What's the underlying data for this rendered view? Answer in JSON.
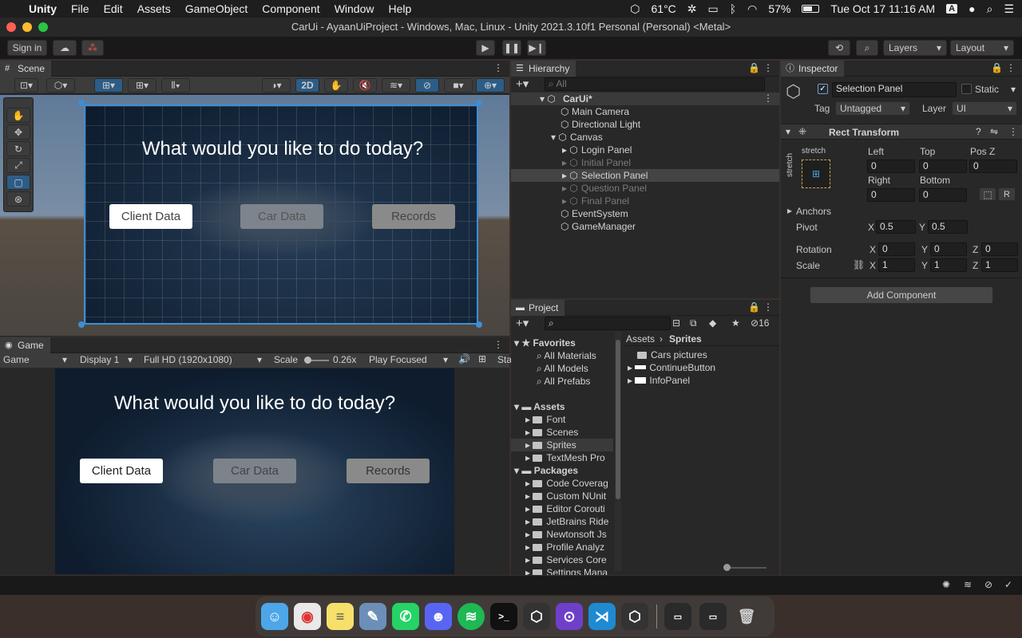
{
  "menubar": {
    "app": "Unity",
    "items": [
      "File",
      "Edit",
      "Assets",
      "GameObject",
      "Component",
      "Window",
      "Help"
    ],
    "temp": "61°C",
    "battery": "57%",
    "datetime": "Tue Oct 17  11:16 AM",
    "input": "A"
  },
  "window": {
    "title": "CarUi - AyaanUiProject - Windows, Mac, Linux - Unity 2021.3.10f1 Personal (Personal) <Metal>"
  },
  "toolbar": {
    "signin": "Sign in",
    "layers": "Layers",
    "layout": "Layout"
  },
  "scene": {
    "tab": "Scene",
    "mode_2d": "2D",
    "heading": "What would you like to do today?",
    "buttons": [
      "Client Data",
      "Car Data",
      "Records"
    ]
  },
  "game": {
    "tab": "Game",
    "display_mode": "Game",
    "display": "Display 1",
    "resolution": "Full HD (1920x1080)",
    "scale_label": "Scale",
    "scale_value": "0.26x",
    "play_mode": "Play Focused",
    "stats": "Sta",
    "heading": "What would you like to do today?",
    "buttons": [
      "Client Data",
      "Car Data",
      "Records"
    ]
  },
  "hierarchy": {
    "tab": "Hierarchy",
    "search_placeholder": "All",
    "scene_name": "CarUi*",
    "items": [
      {
        "label": "Main Camera",
        "indent": 1,
        "active": true
      },
      {
        "label": "Directional Light",
        "indent": 1,
        "active": true
      },
      {
        "label": "Canvas",
        "indent": 1,
        "active": true
      },
      {
        "label": "Login Panel",
        "indent": 2,
        "active": true
      },
      {
        "label": "Initial Panel",
        "indent": 2,
        "active": false
      },
      {
        "label": "Selection Panel",
        "indent": 2,
        "active": true,
        "selected": true
      },
      {
        "label": "Question Panel",
        "indent": 2,
        "active": false
      },
      {
        "label": "Final Panel",
        "indent": 2,
        "active": false
      },
      {
        "label": "EventSystem",
        "indent": 1,
        "active": true
      },
      {
        "label": "GameManager",
        "indent": 1,
        "active": true
      }
    ]
  },
  "project": {
    "tab": "Project",
    "hidden_count": "16",
    "favorites": {
      "label": "Favorites",
      "items": [
        "All Materials",
        "All Models",
        "All Prefabs"
      ]
    },
    "assets": {
      "label": "Assets",
      "items": [
        "Font",
        "Scenes",
        "Sprites",
        "TextMesh Pro"
      ]
    },
    "packages": {
      "label": "Packages",
      "items": [
        "Code Coverag",
        "Custom NUnit",
        "Editor Corouti",
        "JetBrains Ride",
        "Newtonsoft Js",
        "Profile Analyz",
        "Services Core",
        "Settings Mana"
      ]
    },
    "breadcrumb": [
      "Assets",
      "Sprites"
    ],
    "files": [
      "Cars pictures",
      "ContinueButton",
      "InfoPanel"
    ]
  },
  "inspector": {
    "tab": "Inspector",
    "object_name": "Selection Panel",
    "static_label": "Static",
    "tag_label": "Tag",
    "tag_value": "Untagged",
    "layer_label": "Layer",
    "layer_value": "UI",
    "rect": {
      "title": "Rect Transform",
      "stretch": "stretch",
      "left_label": "Left",
      "top_label": "Top",
      "posz_label": "Pos Z",
      "left": "0",
      "top": "0",
      "posz": "0",
      "right_label": "Right",
      "bottom_label": "Bottom",
      "right": "0",
      "bottom": "0",
      "r_btn": "R",
      "anchors": "Anchors",
      "pivot_label": "Pivot",
      "pivot_x": "0.5",
      "pivot_y": "0.5",
      "rotation_label": "Rotation",
      "rot_x": "0",
      "rot_y": "0",
      "rot_z": "0",
      "scale_label": "Scale",
      "scale_x": "1",
      "scale_y": "1",
      "scale_z": "1",
      "x": "X",
      "y": "Y",
      "z": "Z"
    },
    "add_component": "Add Component"
  },
  "colors": {
    "accent": "#2c5d87",
    "selected_row": "#2c5d87",
    "panel": "#282828"
  }
}
